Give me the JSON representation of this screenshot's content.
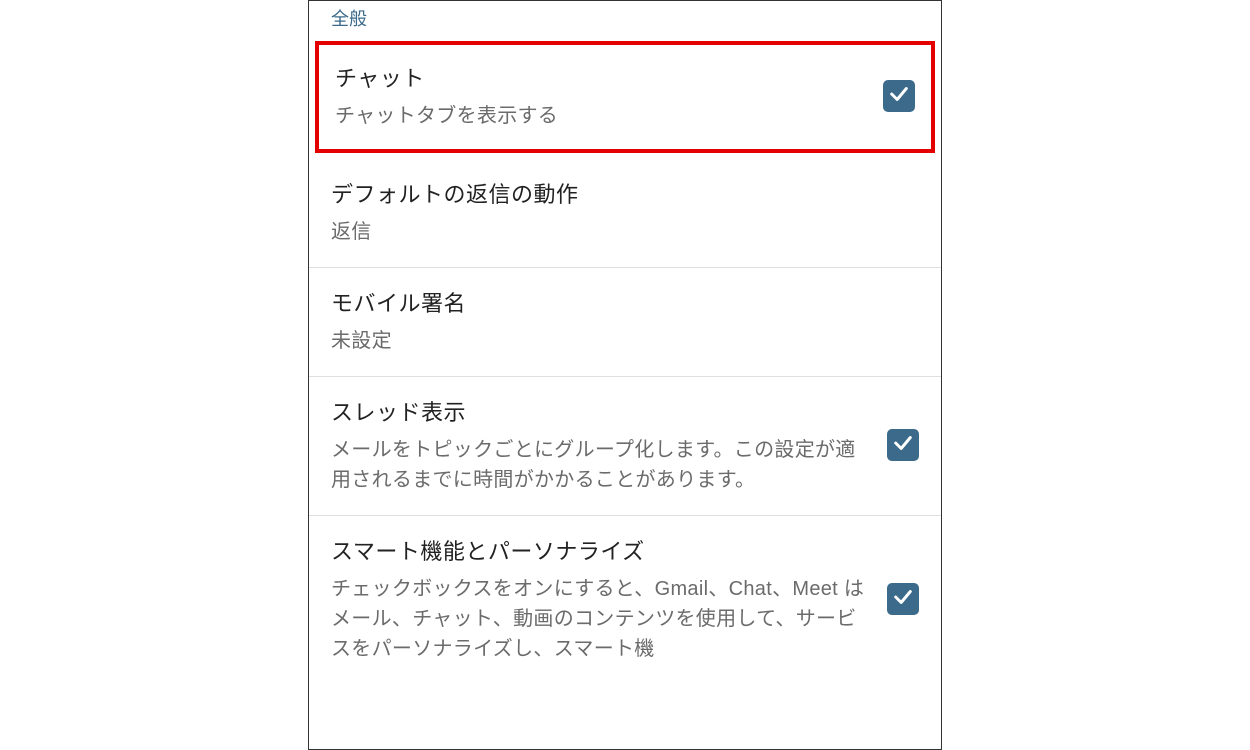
{
  "section_header": "全般",
  "settings": [
    {
      "title": "チャット",
      "desc": "チャットタブを表示する",
      "checked": true,
      "highlighted": true
    },
    {
      "title": "デフォルトの返信の動作",
      "desc": "返信",
      "checked": null,
      "highlighted": false
    },
    {
      "title": "モバイル署名",
      "desc": "未設定",
      "checked": null,
      "highlighted": false
    },
    {
      "title": "スレッド表示",
      "desc": "メールをトピックごとにグループ化します。この設定が適用されるまでに時間がかかることがあります。",
      "checked": true,
      "highlighted": false
    },
    {
      "title": "スマート機能とパーソナライズ",
      "desc": "チェックボックスをオンにすると、Gmail、Chat、Meet はメール、チャット、動画のコンテンツを使用して、サービスをパーソナライズし、スマート機",
      "checked": true,
      "highlighted": false
    }
  ]
}
